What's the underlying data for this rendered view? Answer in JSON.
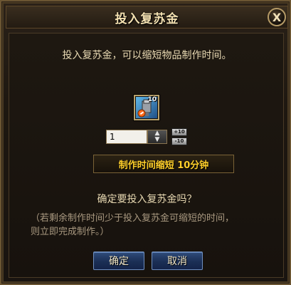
{
  "dialog": {
    "title": "投入复苏金",
    "close_label": "X",
    "subtitle": "投入复苏金，可以缩短物品制作时间。",
    "item": {
      "icon": "armor-item-icon",
      "count": "10"
    },
    "quantity": {
      "value": "1",
      "spin_up": "▲",
      "spin_down": "▼"
    },
    "step_buttons": {
      "plus": "+10",
      "minus": "-10"
    },
    "time_reduction_text": "制作时间缩短 10分钟",
    "question": "确定要投入复苏金吗？",
    "note_line1": "（若剩余制作时间少于投入复苏金可缩短的时间，",
    "note_line2": "则立即完成制作。）",
    "ok_label": "确定",
    "cancel_label": "取消"
  },
  "colors": {
    "accent_gold": "#ffcf2a",
    "button_blue": "#1b2f55",
    "text_main": "#e8d9b2"
  }
}
